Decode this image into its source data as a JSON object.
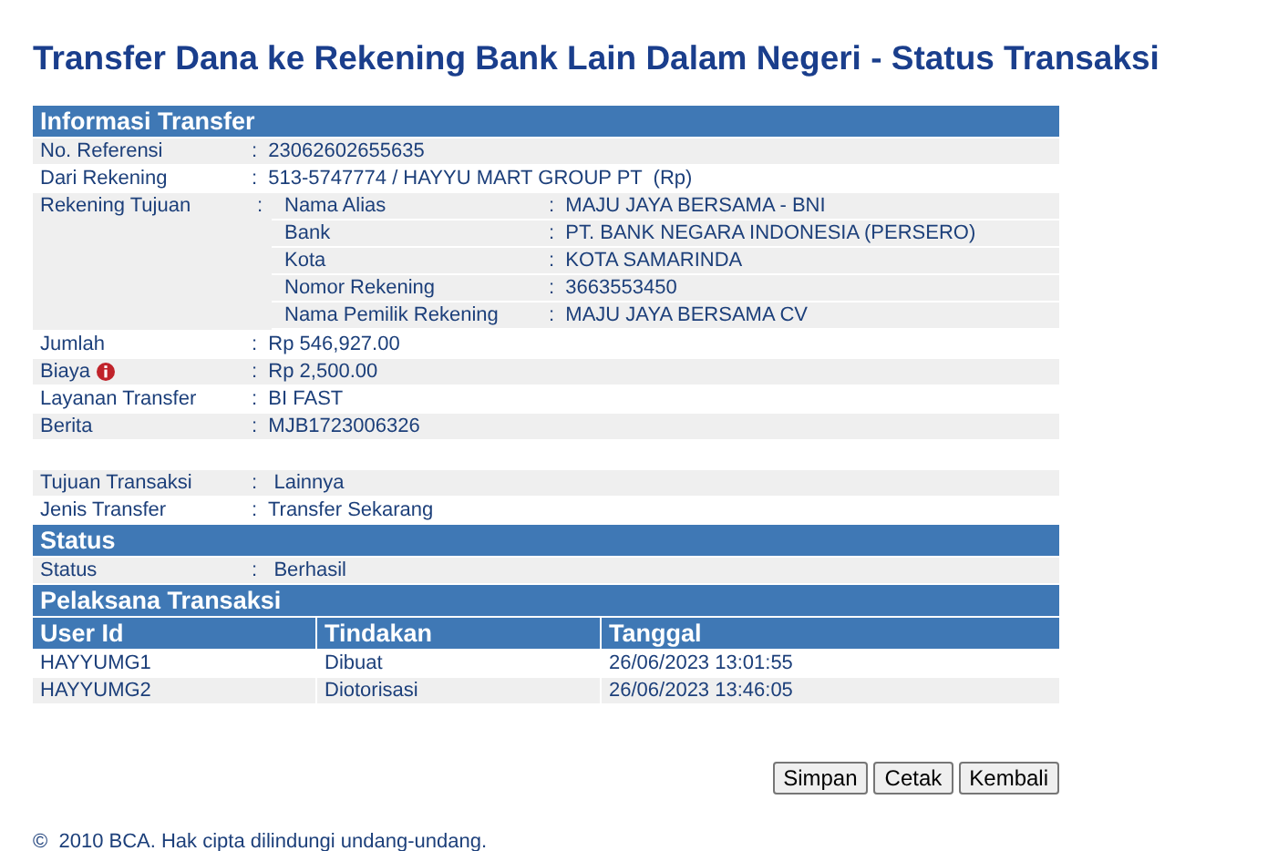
{
  "title": "Transfer Dana ke Rekening Bank Lain Dalam Negeri - Status Transaksi",
  "info": {
    "heading": "Informasi Transfer",
    "rows": [
      {
        "kind": "text",
        "label": "No. Referensi",
        "value": ":  23062602655635"
      },
      {
        "kind": "text",
        "label": "Dari Rekening",
        "value": ":  513-5747774 / HAYYU MART GROUP PT  (Rp)"
      },
      {
        "kind": "nested",
        "label": "Rekening Tujuan",
        "colon": ":",
        "children": [
          {
            "label": "Nama Alias",
            "value": ":  MAJU JAYA BERSAMA - BNI"
          },
          {
            "label": "Bank",
            "value": ":  PT. BANK NEGARA INDONESIA (PERSERO)"
          },
          {
            "label": "Kota",
            "value": ":  KOTA SAMARINDA"
          },
          {
            "label": "Nomor Rekening",
            "value": ":  3663553450"
          },
          {
            "label": "Nama Pemilik Rekening",
            "value": ":  MAJU JAYA BERSAMA CV"
          }
        ]
      },
      {
        "kind": "text",
        "label": "Jumlah",
        "value": ":  Rp 546,927.00"
      },
      {
        "kind": "info",
        "label": "Biaya",
        "value": ":  Rp 2,500.00"
      },
      {
        "kind": "text",
        "label": "Layanan Transfer",
        "value": ":  BI FAST"
      },
      {
        "kind": "text",
        "label": "Berita",
        "value": ":  MJB1723006326"
      }
    ],
    "extra_rows": [
      {
        "label": "Tujuan Transaksi",
        "value": ":   Lainnya"
      },
      {
        "label": "Jenis Transfer",
        "value": ":  Transfer Sekarang"
      }
    ]
  },
  "status": {
    "heading": "Status",
    "rows": [
      {
        "label": "Status",
        "value": ":   Berhasil"
      }
    ]
  },
  "executors": {
    "heading": "Pelaksana Transaksi",
    "columns": [
      "User Id",
      "Tindakan",
      "Tanggal"
    ],
    "rows": [
      [
        "HAYYUMG1",
        "Dibuat",
        "26/06/2023 13:01:55"
      ],
      [
        "HAYYUMG2",
        "Diotorisasi",
        "26/06/2023 13:46:05"
      ]
    ]
  },
  "buttons": [
    "Simpan",
    "Cetak",
    "Kembali"
  ],
  "footer": "©  2010 BCA. Hak cipta dilindungi undang-undang."
}
